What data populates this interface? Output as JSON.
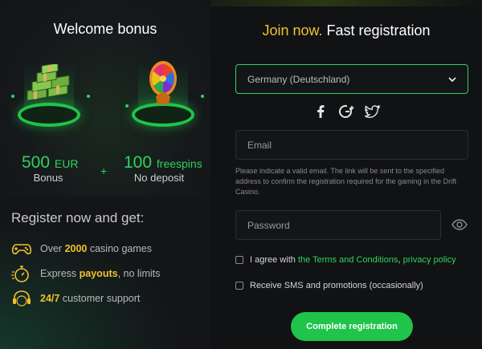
{
  "bonus": {
    "title": "Welcome bonus",
    "cash": {
      "amount": "500",
      "unit": "EUR",
      "label": "Bonus"
    },
    "plus": "+",
    "spins": {
      "amount": "100",
      "unit": "freespins",
      "label": "No deposit"
    }
  },
  "register": {
    "title": "Register now and get:",
    "features": [
      {
        "icon": "gamepad-icon",
        "pre": "Over ",
        "highlight": "2000",
        "post": " casino games"
      },
      {
        "icon": "stopwatch-icon",
        "pre": "Express ",
        "highlight": "payouts",
        "post": ", no limits"
      },
      {
        "icon": "support-24-icon",
        "pre": "",
        "highlight": "24/7",
        "post": " customer support"
      }
    ]
  },
  "form": {
    "title_accent": "Join now.",
    "title_rest": " Fast registration",
    "country_value": "Germany (Deutschland)",
    "socials": [
      "facebook-icon",
      "google-plus-icon",
      "twitter-icon"
    ],
    "email_placeholder": "Email",
    "email_hint": "Please indicate a valid email. The link will be sent to the specified address to confirm the registration required for the gaming in the Drift Casino.",
    "password_placeholder": "Password",
    "terms_pre": "I agree with ",
    "terms_link": "the Terms and Conditions",
    "terms_sep": ", ",
    "privacy_link": "privacy policy",
    "sms_label": "Receive SMS and promotions (occasionally)",
    "submit_label": "Complete registration"
  },
  "colors": {
    "accent_green": "#20c44a",
    "accent_yellow": "#f2c12e",
    "background": "#111214"
  }
}
